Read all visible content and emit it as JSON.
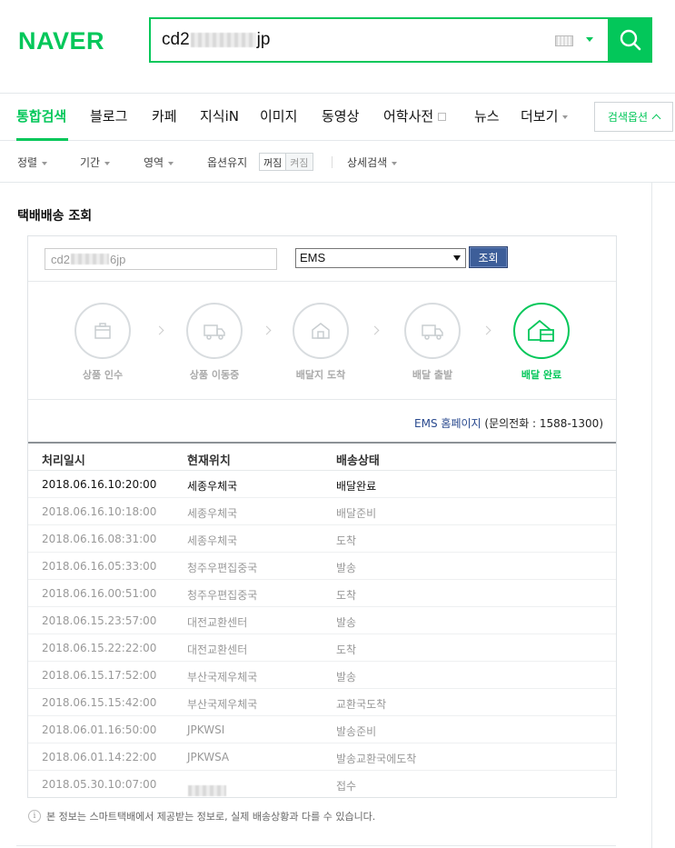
{
  "brand": {
    "logo": "NAVER",
    "accent": "#03c75a"
  },
  "search": {
    "query_prefix": "cd2",
    "query_suffix": "jp"
  },
  "tabs": [
    {
      "label": "통합검색",
      "active": true
    },
    {
      "label": "블로그"
    },
    {
      "label": "카페"
    },
    {
      "label": "지식iN"
    },
    {
      "label": "이미지"
    },
    {
      "label": "동영상"
    },
    {
      "label": "어학사전",
      "icon": "external-window-icon"
    },
    {
      "label": "뉴스"
    },
    {
      "label": "더보기"
    }
  ],
  "search_options": "검색옵션",
  "filters": {
    "sort": "정렬",
    "period": "기간",
    "area": "영역",
    "keep_options": "옵션유지",
    "off": "꺼짐",
    "on": "켜짐",
    "detail": "상세검색"
  },
  "section_title": "택배배송 조회",
  "tracker": {
    "invoice_prefix": "cd2",
    "invoice_suffix": "6jp",
    "carrier": "EMS",
    "query_button": "조회",
    "steps": [
      {
        "label": "상품 인수",
        "icon": "box-icon"
      },
      {
        "label": "상품 이동중",
        "icon": "truck-icon"
      },
      {
        "label": "배달지 도착",
        "icon": "house-icon"
      },
      {
        "label": "배달 출발",
        "icon": "truck-icon"
      },
      {
        "label": "배달 완료",
        "icon": "house-box-icon",
        "done": true
      }
    ],
    "homepage_link": "EMS 홈페이지",
    "phone": "(문의전화 : 1588-1300)"
  },
  "table": {
    "headers": [
      "처리일시",
      "현재위치",
      "배송상태"
    ],
    "rows": [
      [
        "2018.06.16.10:20:00",
        "세종우체국",
        "배달완료"
      ],
      [
        "2018.06.16.10:18:00",
        "세종우체국",
        "배달준비"
      ],
      [
        "2018.06.16.08:31:00",
        "세종우체국",
        "도착"
      ],
      [
        "2018.06.16.05:33:00",
        "청주우편집중국",
        "발송"
      ],
      [
        "2018.06.16.00:51:00",
        "청주우편집중국",
        "도착"
      ],
      [
        "2018.06.15.23:57:00",
        "대전교환센터",
        "발송"
      ],
      [
        "2018.06.15.22:22:00",
        "대전교환센터",
        "도착"
      ],
      [
        "2018.06.15.17:52:00",
        "부산국제우체국",
        "발송"
      ],
      [
        "2018.06.15.15:42:00",
        "부산국제우체국",
        "교환국도착"
      ],
      [
        "2018.06.01.16:50:00",
        "JPKWSI",
        "발송준비"
      ],
      [
        "2018.06.01.14:22:00",
        "JPKWSA",
        "발송교환국에도착"
      ],
      [
        "2018.05.30.10:07:00",
        "",
        "접수"
      ]
    ]
  },
  "notice": "본 정보는 스마트택배에서 제공받는 정보로, 실제 배송상황과 다를 수 있습니다."
}
